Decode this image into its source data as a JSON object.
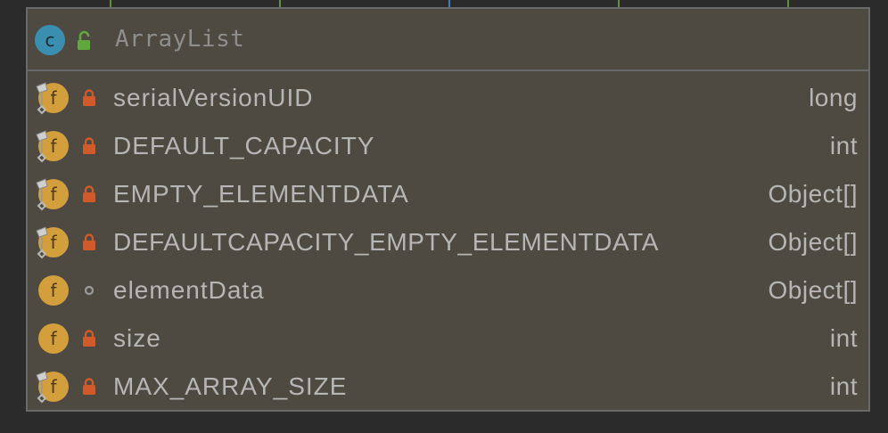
{
  "diagram": {
    "class_badge": "c",
    "class_name": "ArrayList",
    "fields": [
      {
        "icon": "static-field-icon",
        "visibility": "private-lock-icon",
        "name": "serialVersionUID",
        "type": "long"
      },
      {
        "icon": "static-field-icon",
        "visibility": "private-lock-icon",
        "name": "DEFAULT_CAPACITY",
        "type": "int"
      },
      {
        "icon": "static-field-icon",
        "visibility": "private-lock-icon",
        "name": "EMPTY_ELEMENTDATA",
        "type": "Object[]"
      },
      {
        "icon": "static-field-icon",
        "visibility": "private-lock-icon",
        "name": "DEFAULTCAPACITY_EMPTY_ELEMENTDATA",
        "type": "Object[]"
      },
      {
        "icon": "field-icon",
        "visibility": "package-private-dot-icon",
        "name": "elementData",
        "type": "Object[]"
      },
      {
        "icon": "field-icon",
        "visibility": "private-lock-icon",
        "name": "size",
        "type": "int"
      },
      {
        "icon": "static-field-icon",
        "visibility": "private-lock-icon",
        "name": "MAX_ARRAY_SIZE",
        "type": "int"
      }
    ],
    "field_icon_letter": "f"
  },
  "colors": {
    "background": "#2b2b2b",
    "card": "#4e4a42",
    "class_badge": "#3a8fb0",
    "field_badge": "#d39e3c",
    "lock": "#d05a2a",
    "unlock": "#5fa83e",
    "guide_green": "#5f8f3f",
    "guide_blue": "#3f7fbf"
  }
}
